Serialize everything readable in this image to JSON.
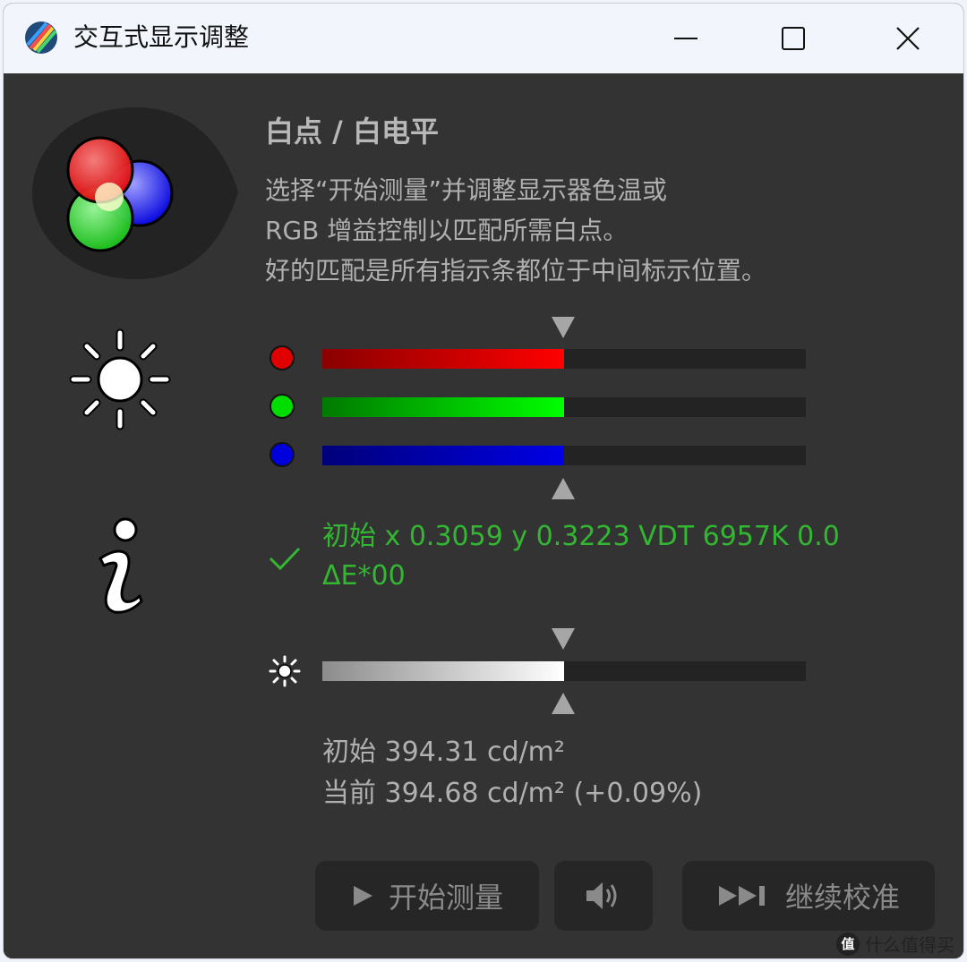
{
  "window": {
    "title": "交互式显示调整"
  },
  "section": {
    "title": "白点 / 白电平",
    "description_lines": [
      "选择“开始测量”并调整显示器色温或",
      "RGB 增益控制以匹配所需白点。",
      "好的匹配是所有指示条都位于中间标示位置。"
    ]
  },
  "rgb_bars": [
    {
      "channel": "red",
      "level": 0.5,
      "color": "#e00000"
    },
    {
      "channel": "green",
      "level": 0.5,
      "color": "#00dd00"
    },
    {
      "channel": "blue",
      "level": 0.5,
      "color": "#0000cc"
    }
  ],
  "status": {
    "text": "初始 x 0.3059 y 0.3223 VDT 6957K 0.0 ΔE*00",
    "color": "#33b733"
  },
  "luminance": {
    "level": 0.5,
    "initial": "初始 394.31 cd/m²",
    "current": "当前 394.68 cd/m² (+0.09%)"
  },
  "buttons": {
    "start": "开始测量",
    "continue": "继续校准"
  },
  "watermark": {
    "badge": "值",
    "text": "什么值得买"
  },
  "colors": {
    "background": "#333333",
    "titlebar": "#f2f6fc"
  }
}
